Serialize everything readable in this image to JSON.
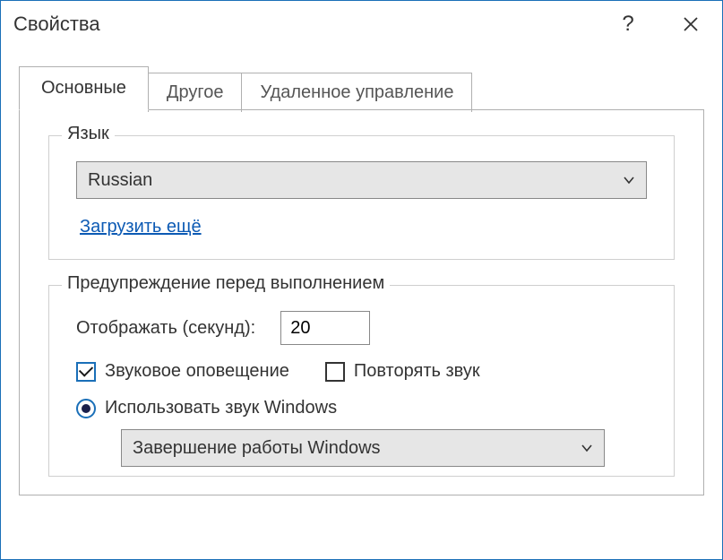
{
  "window": {
    "title": "Свойства"
  },
  "tabs": [
    {
      "label": "Основные",
      "active": true
    },
    {
      "label": "Другое",
      "active": false
    },
    {
      "label": "Удаленное управление",
      "active": false
    }
  ],
  "language_group": {
    "legend": "Язык",
    "selected": "Russian",
    "load_more_link": "Загрузить ещё"
  },
  "warning_group": {
    "legend": "Предупреждение перед выполнением",
    "display_seconds_label": "Отображать (секунд):",
    "display_seconds_value": "20",
    "sound_alert_label": "Звуковое оповещение",
    "sound_alert_checked": true,
    "repeat_sound_label": "Повторять звук",
    "repeat_sound_checked": false,
    "use_windows_sound_label": "Использовать звук Windows",
    "use_windows_sound_selected": true,
    "windows_sound_selected": "Завершение работы Windows"
  }
}
